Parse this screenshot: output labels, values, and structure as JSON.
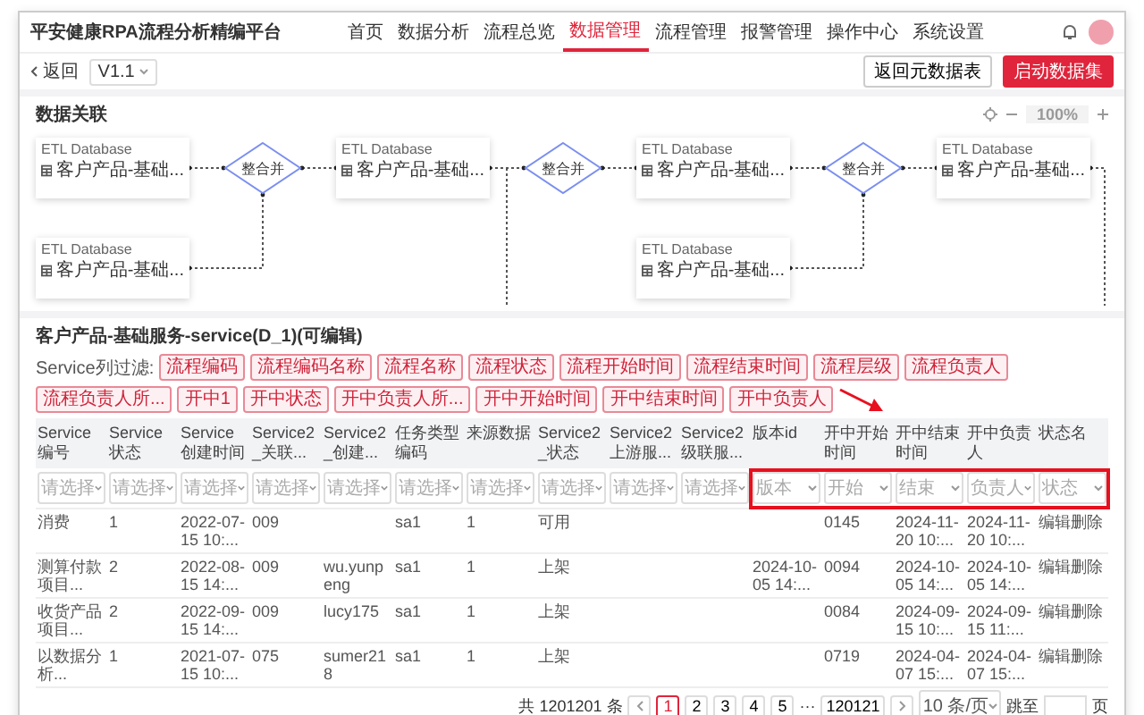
{
  "app": {
    "title": "平安健康RPA流程分析精编平台",
    "nav": [
      {
        "label": "首页",
        "selected": false
      },
      {
        "label": "数据分析",
        "selected": false
      },
      {
        "label": "流程总览",
        "selected": false
      },
      {
        "label": "数据管理",
        "selected": true
      },
      {
        "label": "流程管理",
        "selected": false
      },
      {
        "label": "报警管理",
        "selected": false
      },
      {
        "label": "操作中心",
        "selected": false
      },
      {
        "label": "系统设置",
        "selected": false
      }
    ]
  },
  "toolbar": {
    "back": "返回",
    "version": "V1.1",
    "buttons": [
      {
        "label": "返回元数据表",
        "kind": "secondary"
      },
      {
        "label": "启动数据集",
        "kind": "primary"
      }
    ]
  },
  "diagram": {
    "title": "数据关联",
    "zoom": "100%",
    "flow": [
      {
        "kind": "table",
        "type": "ETL Database",
        "name": "客户产品-基础..."
      },
      {
        "kind": "merge",
        "label": "整合并"
      },
      {
        "kind": "table",
        "type": "ETL Database",
        "name": "客户产品-基础..."
      },
      {
        "kind": "merge",
        "label": "整合并"
      },
      {
        "kind": "table",
        "type": "ETL Database",
        "name": "客户产品-基础..."
      },
      {
        "kind": "merge",
        "label": "整合并"
      },
      {
        "kind": "table",
        "type": "ETL Database",
        "name": "客户产品-基础..."
      }
    ],
    "inputs": [
      {
        "type": "ETL Database",
        "name": "客户产品-基础..."
      },
      {
        "type": "ETL Database",
        "name": "客户产品-基础..."
      }
    ]
  },
  "dataset": {
    "title": "客户产品-基础服务-service(D_1)(可编辑)",
    "filter_label": "Service列过滤:",
    "tags": [
      "流程编码",
      "流程编码名称",
      "流程名称",
      "流程状态",
      "流程开始时间",
      "流程结束时间",
      "流程层级",
      "流程负责人",
      "流程负责人所...",
      "开中1",
      "开中状态",
      "开中负责人所...",
      "开中开始时间",
      "开中结束时间",
      "开中负责人"
    ],
    "columns": [
      {
        "label": "Service编号",
        "filter": "请选择",
        "highlighted": false
      },
      {
        "label": "Service状态",
        "filter": "请选择",
        "highlighted": false
      },
      {
        "label": "Service创建时间",
        "filter": "请选择",
        "highlighted": false
      },
      {
        "label": "Service2_关联...",
        "filter": "请选择",
        "highlighted": false
      },
      {
        "label": "Service2_创建...",
        "filter": "请选择",
        "highlighted": false
      },
      {
        "label": "任务类型编码",
        "filter": "请选择",
        "highlighted": false
      },
      {
        "label": "来源数据",
        "filter": "请选择",
        "highlighted": false
      },
      {
        "label": "Service2_状态",
        "filter": "请选择",
        "highlighted": false
      },
      {
        "label": "Service2上游服...",
        "filter": "请选择",
        "highlighted": false
      },
      {
        "label": "Service2级联服...",
        "filter": "请选择",
        "highlighted": false
      },
      {
        "label": "版本id",
        "filter": "版本",
        "highlighted": true
      },
      {
        "label": "开中开始时间",
        "filter": "开始",
        "highlighted": true
      },
      {
        "label": "开中结束时间",
        "filter": "结束",
        "highlighted": true
      },
      {
        "label": "开中负责人",
        "filter": "负责人",
        "highlighted": true
      },
      {
        "label": "状态名",
        "filter": "状态",
        "highlighted": true
      }
    ],
    "rows": [
      [
        "消费",
        "1",
        "2022-07-15 10:...",
        "009",
        null,
        "sa1",
        "1",
        "可用",
        null,
        null,
        null,
        "0145",
        "2024-11-20 10:...",
        "2024-11-20 10:...",
        "编辑删除"
      ],
      [
        "测算付款项目...",
        "2",
        "2022-08-15 14:...",
        "009",
        "wu.yunpeng",
        "sa1",
        "1",
        "上架",
        null,
        null,
        "2024-10-05 14:...",
        "0094",
        "2024-10-05 14:...",
        "2024-10-05 14:...",
        "编辑删除"
      ],
      [
        "收货产品项目...",
        "2",
        "2022-09-15 14:...",
        "009",
        "lucy175",
        "sa1",
        "1",
        "上架",
        null,
        null,
        null,
        "0084",
        "2024-09-15 10:...",
        "2024-09-15 11:...",
        "编辑删除"
      ],
      [
        "以数据分析...",
        "1",
        "2021-07-15 10:...",
        "075",
        "sumer218",
        "sa1",
        "1",
        "上架",
        null,
        null,
        null,
        "0719",
        "2024-04-07 15:...",
        "2024-04-07 15:...",
        "编辑删除"
      ]
    ],
    "pagination": {
      "total": "共 1201201 条",
      "pages": [
        {
          "label": "1",
          "selected": true
        },
        {
          "label": "2",
          "selected": false
        },
        {
          "label": "3",
          "selected": false
        },
        {
          "label": "4",
          "selected": false
        },
        {
          "label": "5",
          "selected": false
        }
      ],
      "ellipsis": "···",
      "last": "120121",
      "page_size": "10 条/页",
      "jump": "跳至",
      "unit": "页"
    }
  }
}
